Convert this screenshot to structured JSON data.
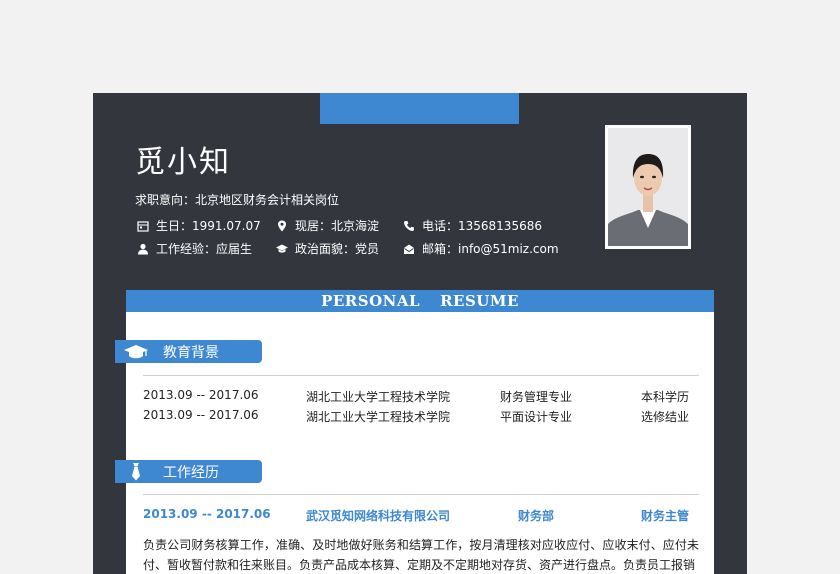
{
  "header": {
    "name": "觅小知",
    "intent": "求职意向：北京地区财务会计相关岗位",
    "info": {
      "birth": "生日：1991.07.07",
      "residence": "现居：北京海淀",
      "phone": "电话：13568135686",
      "experience": "工作经验：应届生",
      "politics": "政治面貌：党员",
      "email": "邮箱：info@51miz.com"
    }
  },
  "banner": {
    "word1": "PERSONAL",
    "word2": "RESUME"
  },
  "education": {
    "title": "教育背景",
    "rows": [
      {
        "period": "2013.09 -- 2017.06",
        "school": "湖北工业大学工程技术学院",
        "major": "财务管理专业",
        "degree": "本科学历"
      },
      {
        "period": "2013.09 -- 2017.06",
        "school": "湖北工业大学工程技术学院",
        "major": "平面设计专业",
        "degree": "选修结业"
      }
    ]
  },
  "work": {
    "title": "工作经历",
    "job": {
      "period": "2013.09 -- 2017.06",
      "company": "武汉觅知网络科技有限公司",
      "department": "财务部",
      "position": "财务主管"
    },
    "description": "负责公司财务核算工作，准确、及时地做好账务和结算工作，按月清理核对应收应付、应收末付、应付未付、暂收暂付款和往来账目。负责产品成本核算、定期及不定期地对存货、资产进行盘点。负责员工报销"
  },
  "colors": {
    "dark": "#33363d",
    "accent": "#3e88d1"
  }
}
